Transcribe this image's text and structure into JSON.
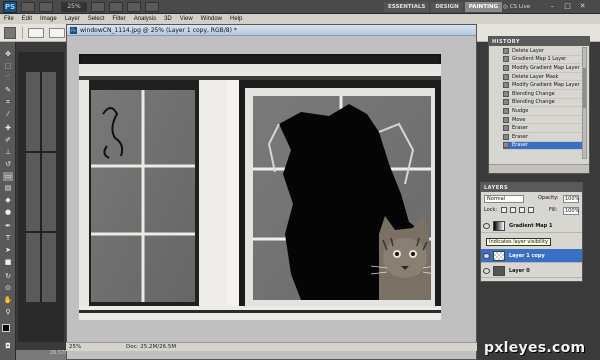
{
  "app": {
    "logo": "PS",
    "zoom": "25%",
    "workspaces": [
      {
        "label": "ESSENTIALS",
        "active": false
      },
      {
        "label": "DESIGN",
        "active": false
      },
      {
        "label": "PAINTING",
        "active": true
      }
    ],
    "cs_live": "CS Live",
    "window_controls": [
      "–",
      "□",
      "✕"
    ]
  },
  "menu": [
    "File",
    "Edit",
    "Image",
    "Layer",
    "Select",
    "Filter",
    "Analysis",
    "3D",
    "View",
    "Window",
    "Help"
  ],
  "document": {
    "title": "windowCN_1114.jpg @ 25% (Layer 1 copy, RGB/8) *",
    "status_zoom": "25%",
    "status_doc": "Doc: 25.2M/26.5M",
    "left_status": "26.57M"
  },
  "history": {
    "tab": "HISTORY",
    "items": [
      {
        "label": "Delete Layer",
        "selected": false
      },
      {
        "label": "Gradient Map 1 Layer",
        "selected": false
      },
      {
        "label": "Modify Gradient Map Layer",
        "selected": false
      },
      {
        "label": "Delete Layer Mask",
        "selected": false
      },
      {
        "label": "Modify Gradient Map Layer",
        "selected": false
      },
      {
        "label": "Blending Change",
        "selected": false
      },
      {
        "label": "Blending Change",
        "selected": false
      },
      {
        "label": "Nudge",
        "selected": false
      },
      {
        "label": "Move",
        "selected": false
      },
      {
        "label": "Eraser",
        "selected": false
      },
      {
        "label": "Eraser",
        "selected": false
      },
      {
        "label": "Eraser",
        "selected": true
      }
    ]
  },
  "layers": {
    "tab": "LAYERS",
    "blend_mode": "Normal",
    "opacity_label": "Opacity:",
    "opacity": "100%",
    "lock_label": "Lock:",
    "fill_label": "Fill:",
    "fill": "100%",
    "tooltip": "Indicates layer visibility",
    "items": [
      {
        "name": "Gradient Map 1",
        "selected": false
      },
      {
        "name": "Layer 1 copy",
        "selected": true
      },
      {
        "name": "Layer 0",
        "selected": false
      }
    ]
  },
  "watermark": "pxleyes.com",
  "colors": {
    "accent": "#3a6fc4",
    "panel": "#d8d6d0",
    "canvas_bg": "#7a7a7a"
  }
}
